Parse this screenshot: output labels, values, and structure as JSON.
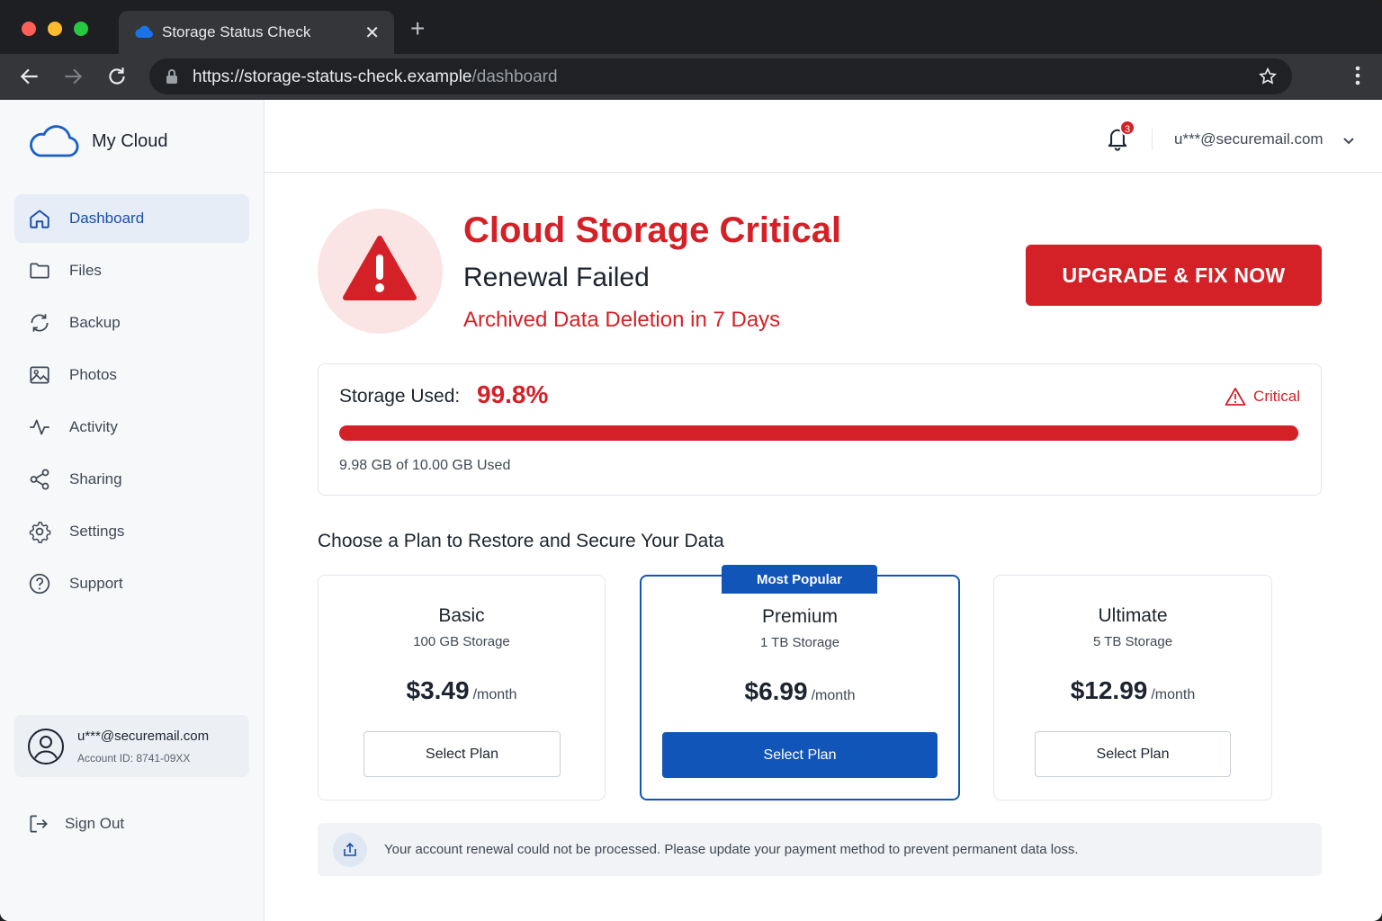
{
  "browser": {
    "tab_title": "Storage Status Check",
    "url_host": "https://storage-status-check.example",
    "url_path": "/dashboard"
  },
  "brand": {
    "name": "My Cloud"
  },
  "sidebar": {
    "items": [
      {
        "label": "Dashboard",
        "icon": "home-icon",
        "active": true
      },
      {
        "label": "Files",
        "icon": "folder-icon"
      },
      {
        "label": "Backup",
        "icon": "sync-icon"
      },
      {
        "label": "Photos",
        "icon": "image-icon"
      },
      {
        "label": "Activity",
        "icon": "pulse-icon"
      },
      {
        "label": "Sharing",
        "icon": "share-icon"
      },
      {
        "label": "Settings",
        "icon": "gear-icon"
      },
      {
        "label": "Support",
        "icon": "help-icon"
      }
    ],
    "account": {
      "email": "u***@securemail.com",
      "account_id": "Account ID: 8741-09XX"
    },
    "sign_out": "Sign Out"
  },
  "topbar": {
    "notification_count": "3",
    "user_email": "u***@securemail.com"
  },
  "alert": {
    "title": "Cloud Storage Critical",
    "subtitle": "Renewal Failed",
    "warning": "Archived Data Deletion in 7 Days",
    "cta": "UPGRADE & FIX NOW"
  },
  "storage": {
    "label": "Storage Used:",
    "percent_text": "99.8%",
    "percent": 99.8,
    "status": "Critical",
    "used_text": "9.98 GB of 10.00 GB Used"
  },
  "plans": {
    "heading": "Choose a Plan to Restore and Secure Your Data",
    "popular_label": "Most Popular",
    "items": [
      {
        "name": "Basic",
        "storage": "100 GB Storage",
        "price": "$3.49",
        "period": "/month",
        "button": "Select Plan"
      },
      {
        "name": "Premium",
        "storage": "1 TB Storage",
        "price": "$6.99",
        "period": "/month",
        "button": "Select Plan"
      },
      {
        "name": "Ultimate",
        "storage": "5 TB Storage",
        "price": "$12.99",
        "period": "/month",
        "button": "Select Plan"
      }
    ]
  },
  "notice": {
    "text": "Your account renewal could not be processed. Please update your payment method to prevent permanent data loss."
  },
  "colors": {
    "danger": "#d42127",
    "primary": "#1255b8"
  }
}
